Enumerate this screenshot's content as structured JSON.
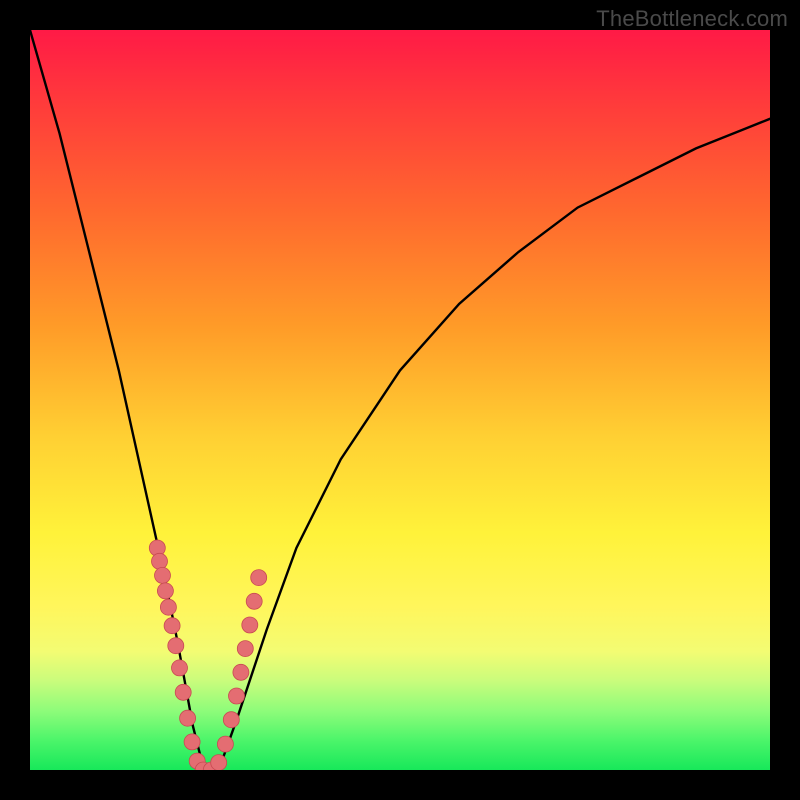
{
  "watermark": "TheBottleneck.com",
  "colors": {
    "frame": "#000000",
    "curve": "#000000",
    "marker_fill": "#e46d72",
    "marker_stroke": "#c84a52"
  },
  "chart_data": {
    "type": "line",
    "title": "",
    "xlabel": "",
    "ylabel": "",
    "xlim": [
      0,
      100
    ],
    "ylim": [
      0,
      100
    ],
    "grid": false,
    "series": [
      {
        "name": "bottleneck-curve",
        "x": [
          0,
          2,
          4,
          6,
          8,
          10,
          12,
          14,
          16,
          18,
          20,
          22,
          23.5,
          25.5,
          28,
          32,
          36,
          42,
          50,
          58,
          66,
          74,
          82,
          90,
          100
        ],
        "y": [
          100,
          93,
          86,
          78,
          70,
          62,
          54,
          45,
          36,
          27,
          17,
          6,
          0,
          0,
          7,
          19,
          30,
          42,
          54,
          63,
          70,
          76,
          80,
          84,
          88
        ]
      }
    ],
    "markers": {
      "name": "highlight-points",
      "x": [
        17.2,
        17.5,
        17.9,
        18.3,
        18.7,
        19.2,
        19.7,
        20.2,
        20.7,
        21.3,
        21.9,
        22.6,
        23.4,
        24.5,
        25.5,
        26.4,
        27.2,
        27.9,
        28.5,
        29.1,
        29.7,
        30.3,
        30.9
      ],
      "y": [
        30.0,
        28.2,
        26.3,
        24.2,
        22.0,
        19.5,
        16.8,
        13.8,
        10.5,
        7.0,
        3.8,
        1.2,
        0.0,
        0.0,
        1.0,
        3.5,
        6.8,
        10.0,
        13.2,
        16.4,
        19.6,
        22.8,
        26.0
      ]
    }
  }
}
